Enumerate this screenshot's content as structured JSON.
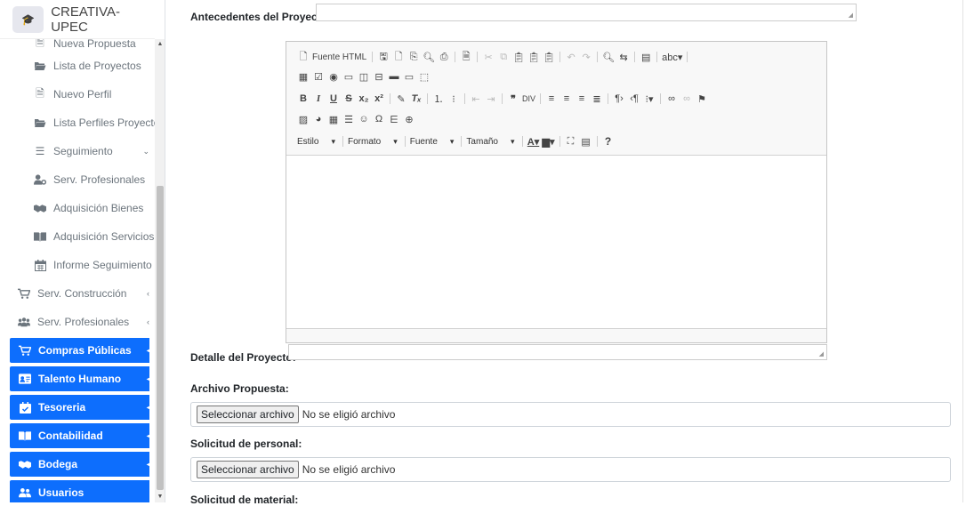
{
  "brand": {
    "title": "CREATIVA-UPEC"
  },
  "sidebar": {
    "items": [
      {
        "label": "Nueva Propuesta",
        "icon": "file-icon"
      },
      {
        "label": "Lista de Proyectos",
        "icon": "folder-open-icon"
      },
      {
        "label": "Nuevo Perfil",
        "icon": "file-icon"
      },
      {
        "label": "Lista Perfiles Proyectos",
        "icon": "folder-open-icon"
      },
      {
        "label": "Seguimiento",
        "icon": "list-icon"
      },
      {
        "label": "Serv. Profesionales",
        "icon": "user-cog-icon"
      },
      {
        "label": "Adquisición Bienes",
        "icon": "handshake-icon"
      },
      {
        "label": "Adquisición Servicios",
        "icon": "book-open-icon"
      },
      {
        "label": "Informe Seguimiento",
        "icon": "calendar-icon"
      },
      {
        "label": "Serv. Construcción",
        "icon": "cart-icon"
      },
      {
        "label": "Serv. Profesionales",
        "icon": "users-icon"
      }
    ],
    "modules": [
      {
        "label": "Compras Públicas",
        "icon": "cart-icon"
      },
      {
        "label": "Talento Humano",
        "icon": "id-card-icon"
      },
      {
        "label": "Tesoreria",
        "icon": "calendar-check-icon"
      },
      {
        "label": "Contabilidad",
        "icon": "book-open-icon"
      },
      {
        "label": "Bodega",
        "icon": "handshake-icon"
      },
      {
        "label": "Usuarios",
        "icon": "users-icon"
      }
    ],
    "accent_color": "#0d6efd"
  },
  "form": {
    "antecedentes_label": "Antecedentes del Proyecto:",
    "detalle_label": "Detalle del Proyecto:",
    "archivo_label": "Archivo Propuesta:",
    "solicitud_personal_label": "Solicitud de personal:",
    "solicitud_material_label": "Solicitud de material:",
    "file_button": "Seleccionar archivo",
    "file_none": "No se eligió archivo"
  },
  "editor": {
    "source_label": "Fuente HTML",
    "combos": {
      "style": "Estilo",
      "format": "Formato",
      "font": "Fuente",
      "size": "Tamaño"
    },
    "help": "?"
  }
}
